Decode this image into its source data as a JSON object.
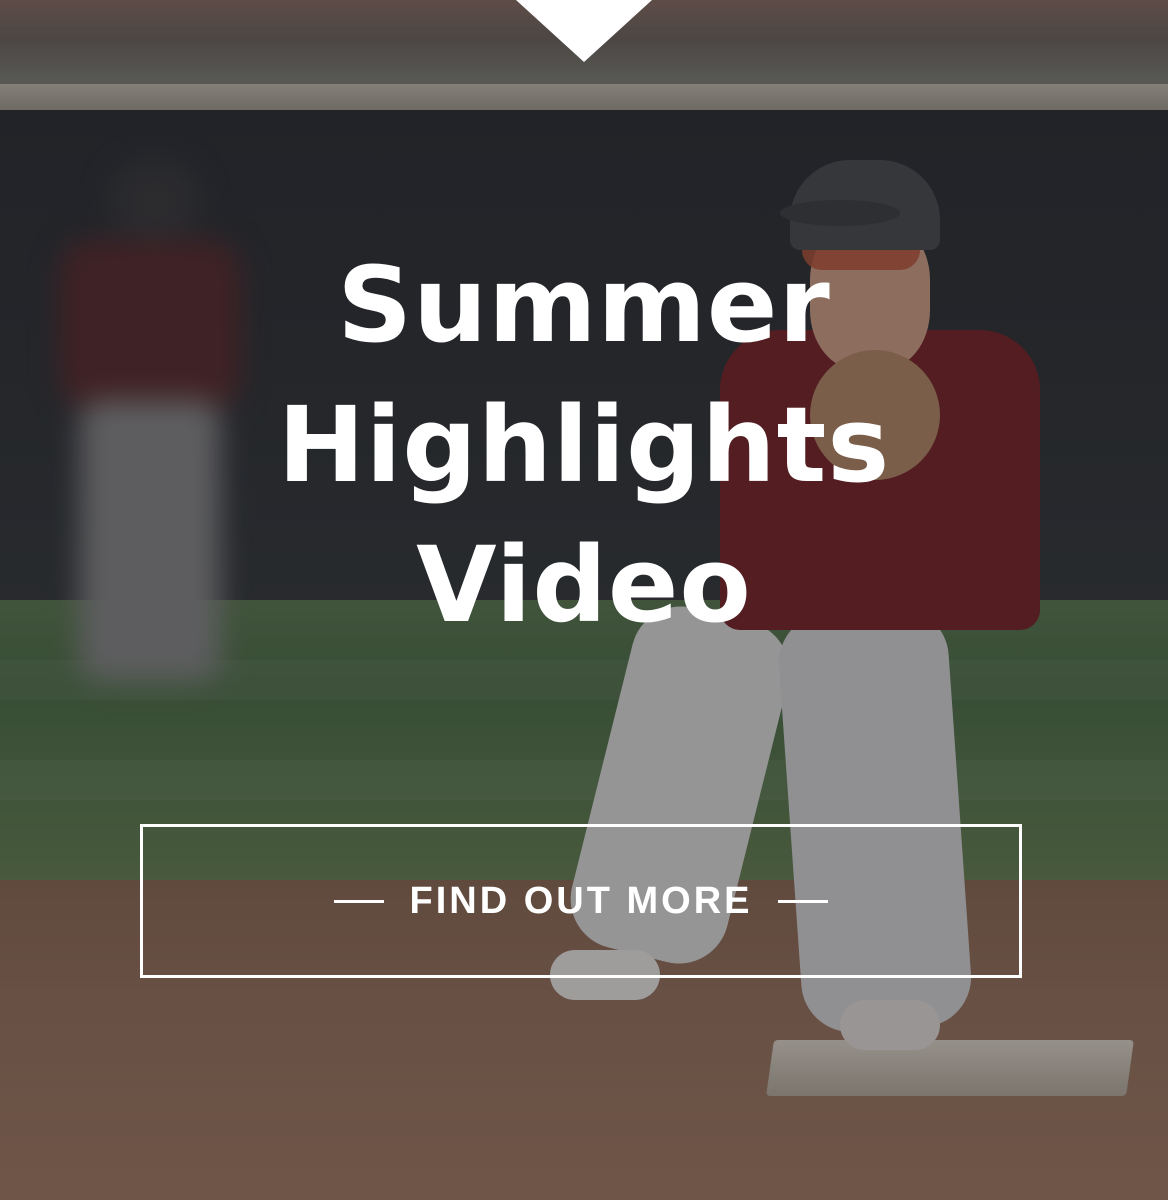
{
  "hero": {
    "title_lines": [
      "Summer",
      "Highlights",
      "Video"
    ],
    "cta_label": "FIND OUT MORE",
    "background_image": "baseball-infielder-photo"
  },
  "colors": {
    "text": "#ffffff",
    "overlay": "rgba(20,20,24,0.38)",
    "notch": "#ffffff"
  },
  "icons": {
    "notch": "caret-down-icon"
  }
}
